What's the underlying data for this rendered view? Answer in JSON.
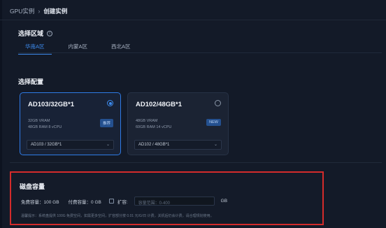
{
  "breadcrumb": {
    "parent": "GPU实例",
    "separator": "›",
    "current": "创建实例"
  },
  "region": {
    "title": "选择区域",
    "info_icon": "info-icon",
    "tabs": [
      {
        "label": "华南A区",
        "active": true
      },
      {
        "label": "内蒙A区",
        "active": false
      },
      {
        "label": "西北A区",
        "active": false
      }
    ]
  },
  "config": {
    "title": "选择配置",
    "cards": [
      {
        "name": "AD103/32GB*1",
        "selected": true,
        "vram": "32GB VRAM",
        "spec": "48GB RAM 8 vCPU",
        "badge": "推荐",
        "select_value": "AD103 / 32GB*1"
      },
      {
        "name": "AD102/48GB*1",
        "selected": false,
        "vram": "48GB VRAM",
        "spec": "60GB RAM 14 vCPU",
        "badge": "NEW",
        "select_value": "AD102 / 48GB*1"
      }
    ]
  },
  "disk": {
    "title": "磁盘容量",
    "free_label": "免费容量：100 GB",
    "paid_label": "付费容量：0 GB",
    "expand_label": "扩容:",
    "expand_placeholder": "容量范围：0-400",
    "unit": "GB",
    "tip": "温馨提示：系统盘提供 100G 免费空间，如需更多空间，扩容部分按 0.01 元/G/日 计费，关机后仍会计费，请合理规划使用。"
  },
  "colors": {
    "background": "#131a28",
    "accent": "#3d8cf0",
    "highlight_border": "#d42b2b"
  }
}
